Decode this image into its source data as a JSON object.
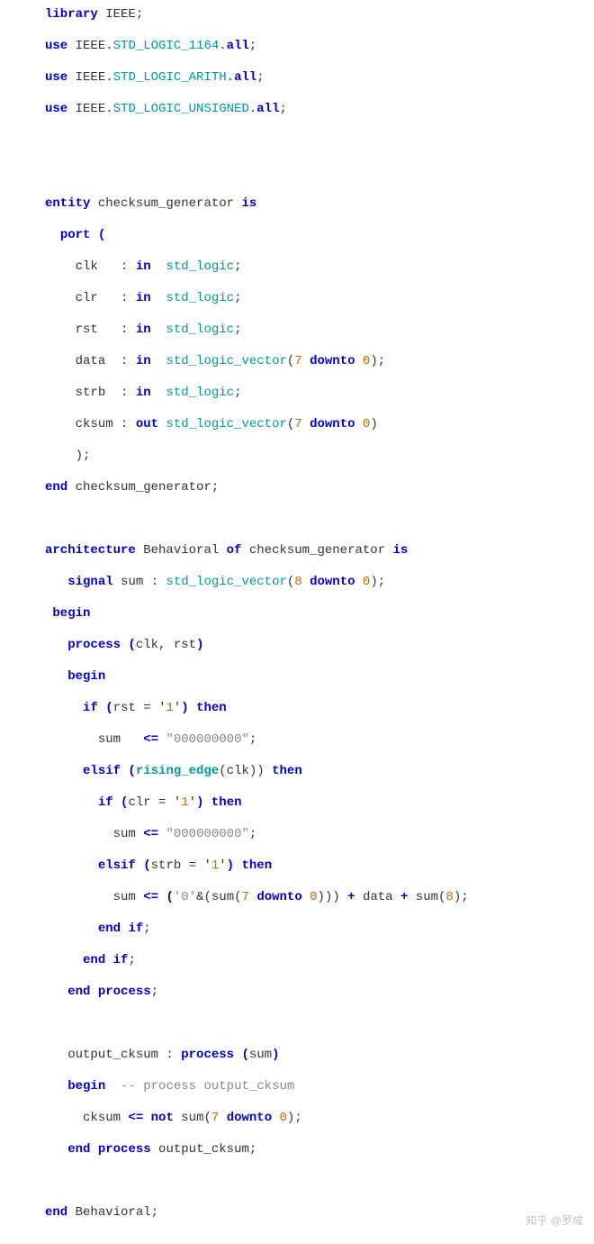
{
  "code": {
    "l1": {
      "library": "library",
      "ieee": "IEEE",
      "semi": ";"
    },
    "l2": {
      "use": "use",
      "ieee": "IEEE",
      "dot1": ".",
      "pkg": "STD_LOGIC_1164",
      "dot2": ".",
      "all": "all",
      "semi": ";"
    },
    "l3": {
      "use": "use",
      "ieee": "IEEE",
      "dot1": ".",
      "pkg": "STD_LOGIC_ARITH",
      "dot2": ".",
      "all": "all",
      "semi": ";"
    },
    "l4": {
      "use": "use",
      "ieee": "IEEE",
      "dot1": ".",
      "pkg": "STD_LOGIC_UNSIGNED",
      "dot2": ".",
      "all": "all",
      "semi": ";"
    },
    "l5": {
      "entity": "entity",
      "name": " checksum_generator ",
      "is": "is"
    },
    "l6": {
      "port": "port",
      "lp": " ("
    },
    "l7": {
      "indent": "    ",
      "name": "clk",
      "sp": "   : ",
      "in": "in",
      "sp2": "  ",
      "type": "std_logic",
      "semi": ";"
    },
    "l8": {
      "indent": "    ",
      "name": "clr",
      "sp": "   : ",
      "in": "in",
      "sp2": "  ",
      "type": "std_logic",
      "semi": ";"
    },
    "l9": {
      "indent": "    ",
      "name": "rst",
      "sp": "   : ",
      "in": "in",
      "sp2": "  ",
      "type": "std_logic",
      "semi": ";"
    },
    "l10": {
      "indent": "    ",
      "name": "data",
      "sp": "  : ",
      "in": "in",
      "sp2": "  ",
      "type": "std_logic_vector",
      "lp": "(",
      "n1": "7",
      "dt": " downto ",
      "n2": "0",
      "rp": ")",
      "semi": ";"
    },
    "l11": {
      "indent": "    ",
      "name": "strb",
      "sp": "  : ",
      "in": "in",
      "sp2": "  ",
      "type": "std_logic",
      "semi": ";"
    },
    "l12": {
      "indent": "    ",
      "name": "cksum",
      "sp": " : ",
      "out": "out",
      "sp2": " ",
      "type": "std_logic_vector",
      "lp": "(",
      "n1": "7",
      "dt": " downto ",
      "n2": "0",
      "rp": ")"
    },
    "l13": {
      "indent": "    ",
      "txt": ");"
    },
    "l14": {
      "end": "end",
      "name": " checksum_generator;"
    },
    "l15": {
      "arch": "architecture",
      "name": " Behavioral ",
      "of": "of",
      "ent": " checksum_generator ",
      "is": "is"
    },
    "l16": {
      "indent": "   ",
      "signal": "signal",
      "name": " sum : ",
      "type": "std_logic_vector",
      "lp": "(",
      "n1": "8",
      "dt": " downto ",
      "n2": "0",
      "rp": ")",
      "semi": ";"
    },
    "l17": {
      "indent": " ",
      "begin": "begin"
    },
    "l18": {
      "indent": "   ",
      "process": "process",
      "lp": " (",
      "args": "clk, rst",
      "rp": ")"
    },
    "l19": {
      "indent": "   ",
      "begin": "begin"
    },
    "l20": {
      "indent": "     ",
      "if": "if",
      "sp": " (",
      "cond": "rst = ",
      "q1": "'",
      "one": "1",
      "q2": "'",
      "rp": ") ",
      "then": "then"
    },
    "l21": {
      "indent": "       ",
      "sig": "sum",
      "sp": "   ",
      "asn": "<=",
      "sp2": " ",
      "val": "\"000000000\"",
      "semi": ";"
    },
    "l22": {
      "indent": "     ",
      "elsif": "elsif",
      "sp": " (",
      "fn": "rising_edge",
      "lp": "(",
      "arg": "clk",
      "rp": "))",
      "sp2": " ",
      "then": "then"
    },
    "l23": {
      "indent": "       ",
      "if": "if",
      "sp": " (",
      "cond": "clr = ",
      "q1": "'",
      "one": "1",
      "q2": "'",
      "rp": ") ",
      "then": "then"
    },
    "l24": {
      "indent": "         ",
      "sig": "sum",
      "sp": " ",
      "asn": "<=",
      "sp2": " ",
      "val": "\"000000000\"",
      "semi": ";"
    },
    "l25": {
      "indent": "       ",
      "elsif": "elsif",
      "sp": " (",
      "cond": "strb = ",
      "q1": "'",
      "one": "1",
      "q2": "'",
      "rp": ") ",
      "then": "then"
    },
    "l26": {
      "indent": "         ",
      "sig": "sum",
      "sp": " ",
      "asn": "<=",
      "sp2": " (",
      "z": "'0'",
      "amp": "&(",
      "sig2": "sum(",
      "n1": "7",
      "dt": " downto ",
      "n2": "0",
      "rp": "))) ",
      "plus1": "+",
      "data": " data ",
      "plus2": "+",
      "sum": " sum(",
      "n3": "8",
      "rp2": ")",
      "semi": ";"
    },
    "l27": {
      "indent": "       ",
      "end": "end",
      "sp": " ",
      "if": "if",
      "semi": ";"
    },
    "l28": {
      "indent": "     ",
      "end": "end",
      "sp": " ",
      "if": "if",
      "semi": ";"
    },
    "l29": {
      "indent": "   ",
      "end": "end",
      "sp": " ",
      "process": "process",
      "semi": ";"
    },
    "l30": {
      "indent": "   ",
      "name": "output_cksum : ",
      "process": "process",
      "lp": " (",
      "arg": "sum",
      "rp": ")"
    },
    "l31": {
      "indent": "   ",
      "begin": "begin",
      "sp": "  ",
      "cmt": "-- process output_cksum"
    },
    "l32": {
      "indent": "     ",
      "sig": "cksum",
      "sp": " ",
      "asn": "<=",
      "sp2": " ",
      "not": "not",
      "sum": " sum(",
      "n1": "7",
      "dt": " downto ",
      "n2": "0",
      "rp": ")",
      "semi": ";"
    },
    "l33": {
      "indent": "   ",
      "end": "end",
      "sp": " ",
      "process": "process",
      "name": " output_cksum;"
    },
    "l34": {
      "end": "end",
      "name": " Behavioral;"
    }
  },
  "watermark": "知乎 @罗成"
}
